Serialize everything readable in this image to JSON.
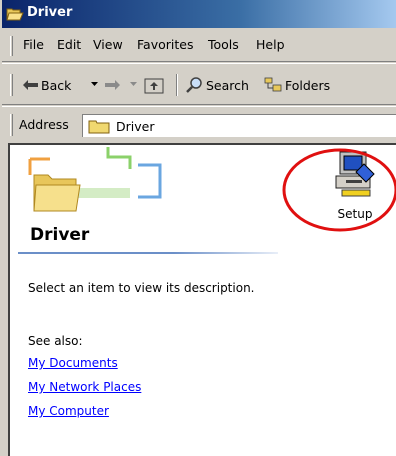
{
  "window": {
    "title": "Driver"
  },
  "menu": {
    "items": [
      "File",
      "Edit",
      "View",
      "Favorites",
      "Tools",
      "Help"
    ]
  },
  "toolbar": {
    "back_label": "Back",
    "search_label": "Search",
    "folders_label": "Folders"
  },
  "address": {
    "label": "Address",
    "value": "Driver"
  },
  "panel": {
    "heading": "Driver",
    "description": "Select an item to view its description.",
    "see_also": "See also:",
    "links": [
      "My Documents",
      "My Network Places",
      "My Computer"
    ]
  },
  "files": [
    {
      "name": "Setup",
      "icon": "setup-program-icon"
    }
  ],
  "colors": {
    "title_bar_start": "#0a246a",
    "title_bar_end": "#a6caf0",
    "link": "#0000ff",
    "highlight_circle": "#e01010"
  }
}
